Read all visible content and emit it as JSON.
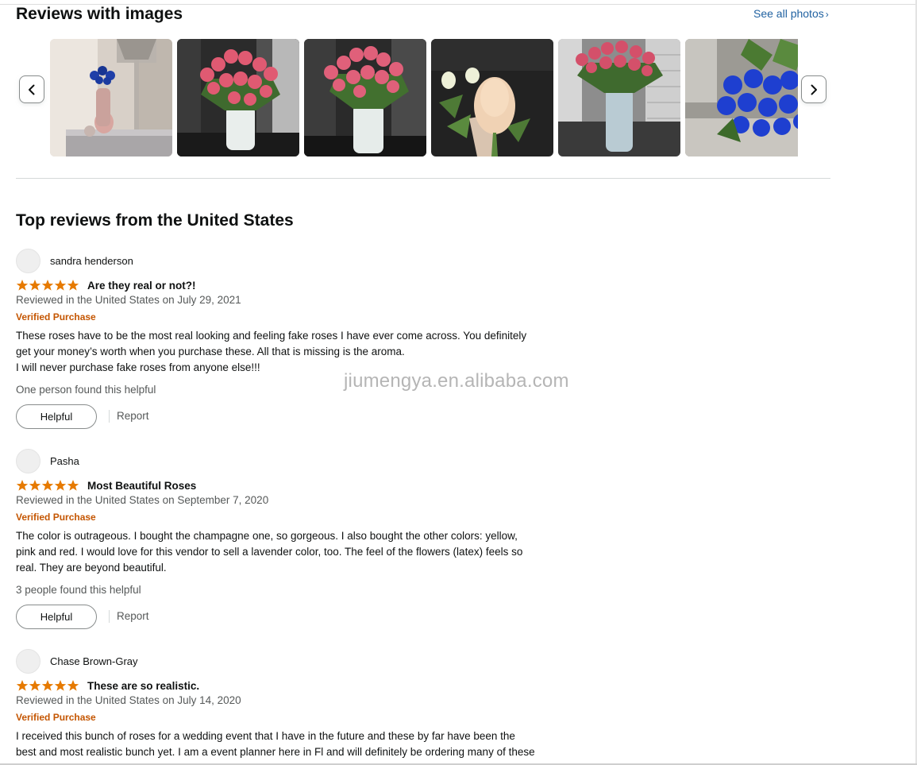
{
  "reviews_with_images": {
    "title": "Reviews with images",
    "see_all_label": "See all photos",
    "see_all_chevron": "›",
    "prev_icon": "chevron-left-icon",
    "next_icon": "chevron-right-icon",
    "thumbnails": [
      {
        "name": "review-image-blue-roses-lamp"
      },
      {
        "name": "review-image-pink-roses-vase"
      },
      {
        "name": "review-image-pink-roses-vase-2"
      },
      {
        "name": "review-image-champagne-rose"
      },
      {
        "name": "review-image-pink-roses-window"
      },
      {
        "name": "review-image-blue-roses-bouquet"
      }
    ]
  },
  "top_reviews": {
    "title": "Top reviews from the United States",
    "reviews": [
      {
        "author": "sandra henderson",
        "rating": 5,
        "title": "Are they real or not?!",
        "date": "Reviewed in the United States on July 29, 2021",
        "verified": "Verified Purchase",
        "body_lines": [
          "These roses have to be the most real looking and feeling fake roses I have ever come across. You definitely",
          "get your money’s worth when you purchase these. All that is missing is the aroma.",
          "I will never purchase fake roses from anyone else!!!"
        ],
        "helpful_text": "One person found this helpful",
        "helpful_label": "Helpful",
        "report_label": "Report"
      },
      {
        "author": "Pasha",
        "rating": 5,
        "title": "Most Beautiful Roses",
        "date": "Reviewed in the United States on September 7, 2020",
        "verified": "Verified Purchase",
        "body_lines": [
          "The color is outrageous. I bought the champagne one, so gorgeous. I also bought the other colors: yellow,",
          "pink and red. I would love for this vendor to sell a lavender color, too. The feel of the flowers (latex) feels so",
          "real. They are beyond beautiful."
        ],
        "helpful_text": "3 people found this helpful",
        "helpful_label": "Helpful",
        "report_label": "Report"
      },
      {
        "author": "Chase Brown-Gray",
        "rating": 5,
        "title": "These are so realistic.",
        "date": "Reviewed in the United States on July 14, 2020",
        "verified": "Verified Purchase",
        "body_lines": [
          "I received this bunch of roses for a wedding event that I have in the future and these by far have been the",
          "best and most realistic bunch yet. I am a event planner here in Fl and will definitely be ordering many of these"
        ],
        "helpful_text": "",
        "helpful_label": "",
        "report_label": ""
      }
    ]
  },
  "watermark": "jiumengya.en.alibaba.com",
  "colors": {
    "star": "#e67a00",
    "link": "#2162a1",
    "verified": "#c45500",
    "secondary_text": "#565959"
  }
}
